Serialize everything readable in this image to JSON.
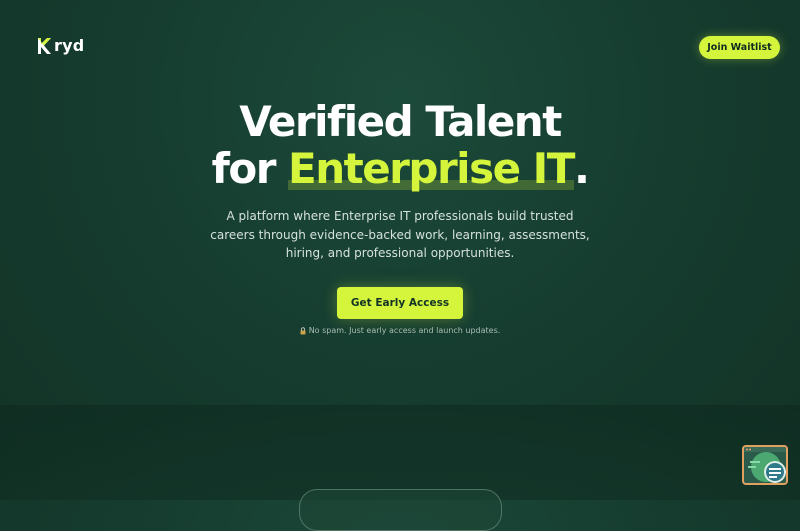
{
  "header": {
    "logo_text": "ryd",
    "logo_mark": "K",
    "join_button_label": "Join Waitlist"
  },
  "hero": {
    "headline_line1": "Verified Talent",
    "headline_prefix": "for ",
    "headline_accent": "Enterprise IT",
    "headline_suffix": ".",
    "subtitle": "A platform where Enterprise IT professionals build trusted careers through evidence-backed work, learning, assessments, hiring, and professional opportunities.",
    "cta_label": "Get Early Access",
    "note_text": "No spam. Just early access and launch updates."
  },
  "colors": {
    "accent": "#d4f53c",
    "background": "#163d30"
  },
  "icons": {
    "logo": "kryd-logo-icon",
    "note": "lock-icon",
    "widget": "chat-widget-icon"
  }
}
